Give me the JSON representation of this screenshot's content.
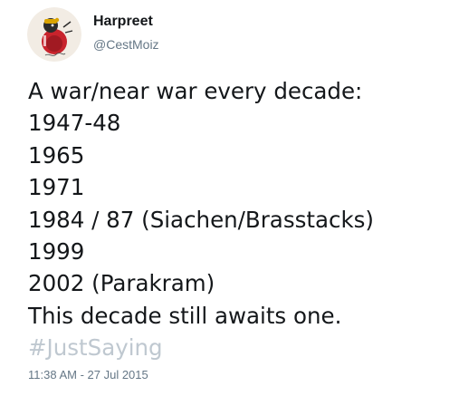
{
  "user": {
    "display_name": "Harpreet",
    "handle": "@CestMoiz",
    "avatar": "profile-picture-round-red-illustration"
  },
  "tweet": {
    "lines": [
      "A war/near war every decade:",
      "1947-48",
      "1965",
      "1971",
      "1984 / 87 (Siachen/Brasstacks)",
      "1999",
      "2002 (Parakram)",
      "This decade still awaits one."
    ],
    "hashtag": "#JustSaying",
    "timestamp": "11:38 AM - 27 Jul 2015"
  },
  "colors": {
    "text": "#14171a",
    "secondary": "#657786",
    "hashtag": "#bfc8d0",
    "background": "#ffffff"
  }
}
